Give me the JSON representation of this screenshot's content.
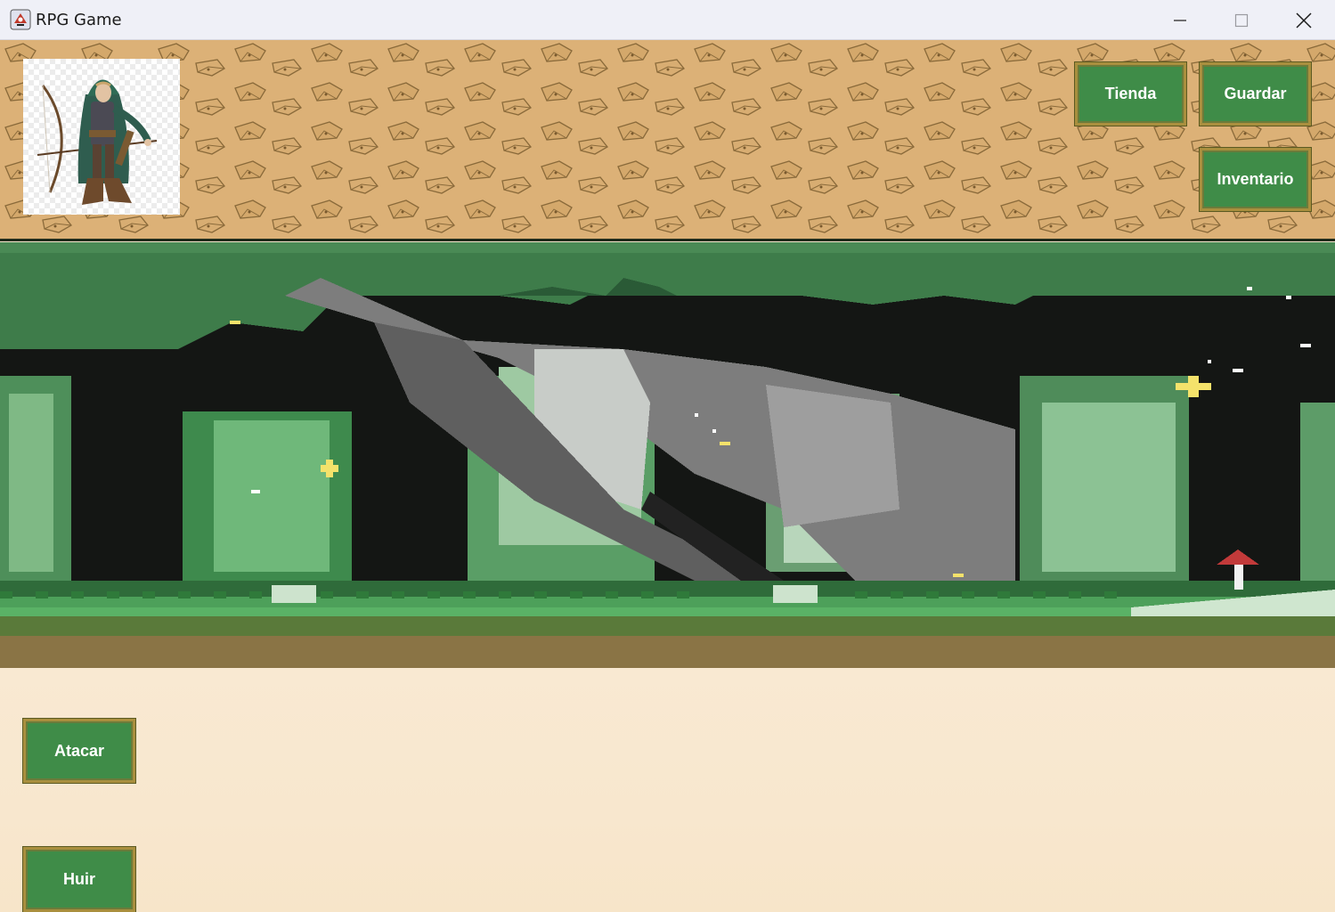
{
  "window": {
    "title": "RPG Game",
    "app_icon": "java-cup-icon",
    "controls": [
      "minimize-icon",
      "maximize-icon",
      "close-icon"
    ]
  },
  "header": {
    "portrait": "elf-archer-character-portrait",
    "buttons": {
      "shop": "Tienda",
      "save": "Guardar",
      "inventory": "Inventario"
    }
  },
  "scene": {
    "description_icon": "pixel-forest-background"
  },
  "actions": {
    "attack": "Atacar",
    "flee": "Huir"
  },
  "colors": {
    "button_green": "#3f8c48",
    "button_border": "#a98f3e",
    "header_tan": "#dcb177",
    "panel_cream": "#f8e8cf"
  }
}
